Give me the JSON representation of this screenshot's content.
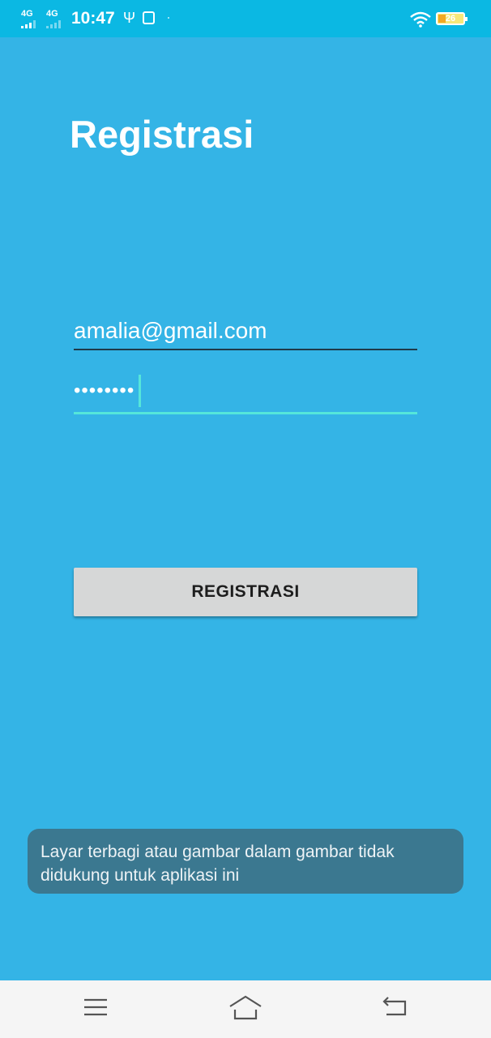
{
  "status_bar": {
    "sim1_type": "4G",
    "sim2_type": "4G",
    "time": "10:47",
    "usb_symbol": "Ψ",
    "battery_level": "26",
    "icons": [
      "signal-icon",
      "usb-icon",
      "notification-icon",
      "wifi-icon",
      "battery-icon"
    ]
  },
  "screen": {
    "title": "Registrasi",
    "email_value": "amalia@gmail.com",
    "password_value": "••••••••",
    "register_button_label": "REGISTRASI"
  },
  "toast": {
    "message": "Layar terbagi atau gambar dalam gambar tidak didukung untuk aplikasi ini"
  },
  "nav_bar": {
    "icons": [
      "menu-icon",
      "home-icon",
      "back-icon"
    ]
  },
  "colors": {
    "background": "#34b4e6",
    "status_bar": "#0bb8e3",
    "accent": "#55e6da",
    "button": "#d6d7d7",
    "toast": "#3b7890"
  }
}
